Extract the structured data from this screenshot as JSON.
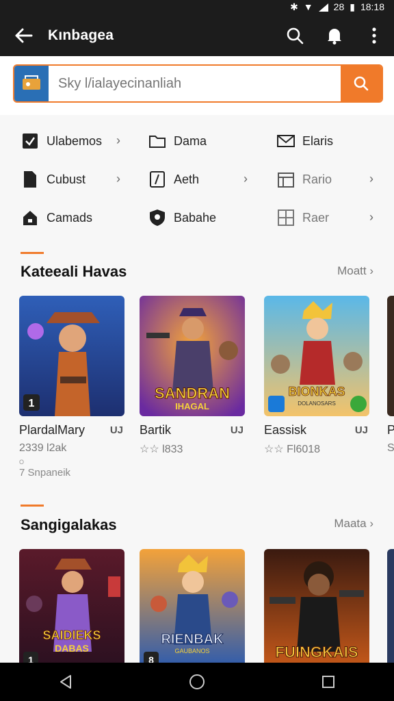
{
  "status": {
    "time": "18:18",
    "battery_label": "28"
  },
  "appbar": {
    "title": "Kınbagea"
  },
  "search": {
    "placeholder": "Sky l/ialayecinanliah"
  },
  "categories": [
    {
      "label": "Ulabemos",
      "icon": "checkbox-icon"
    },
    {
      "label": "Dama",
      "icon": "folder-icon"
    },
    {
      "label": "Elaris",
      "icon": "mail-icon"
    },
    {
      "label": "Cubust",
      "icon": "document-icon"
    },
    {
      "label": "Aeth",
      "icon": "edit-icon"
    },
    {
      "label": "Rario",
      "icon": "calendar-icon"
    },
    {
      "label": "Camads",
      "icon": "home-icon"
    },
    {
      "label": "Babahe",
      "icon": "shield-icon"
    },
    {
      "label": "Raer",
      "icon": "grid-icon"
    }
  ],
  "section1": {
    "title": "Kateeali Havas",
    "more": "Moatt",
    "cards": [
      {
        "name": "PlardalMary",
        "flag": "UJ",
        "sub": "2339 l2ak",
        "sub2": "7 Snpaneik",
        "tiny": "O",
        "badge": "1"
      },
      {
        "name": "Bartik",
        "flag": "UJ",
        "sub": "☆☆ l833",
        "art_title": "SANDRAN",
        "art_sub": "IHAGAL"
      },
      {
        "name": "Eassisk",
        "flag": "UJ",
        "sub": "☆☆ Fl6018",
        "art_title": "BIONKAS",
        "art_sub": "DOLANOSARS"
      },
      {
        "name": "P",
        "sub": "S"
      }
    ]
  },
  "section2": {
    "title": "Sangigalakas",
    "more": "Maata",
    "cards": [
      {
        "art_title": "SAIDIEKS",
        "art_sub": "DABAS",
        "badge": "1"
      },
      {
        "art_title": "RIENBAK",
        "art_sub": "GAUBANOS",
        "badge": "8"
      },
      {
        "art_title": "FUINGKAIS",
        "art_sub": ""
      }
    ]
  },
  "colors": {
    "accent": "#f07a2a",
    "appbar": "#1c1c1c"
  }
}
